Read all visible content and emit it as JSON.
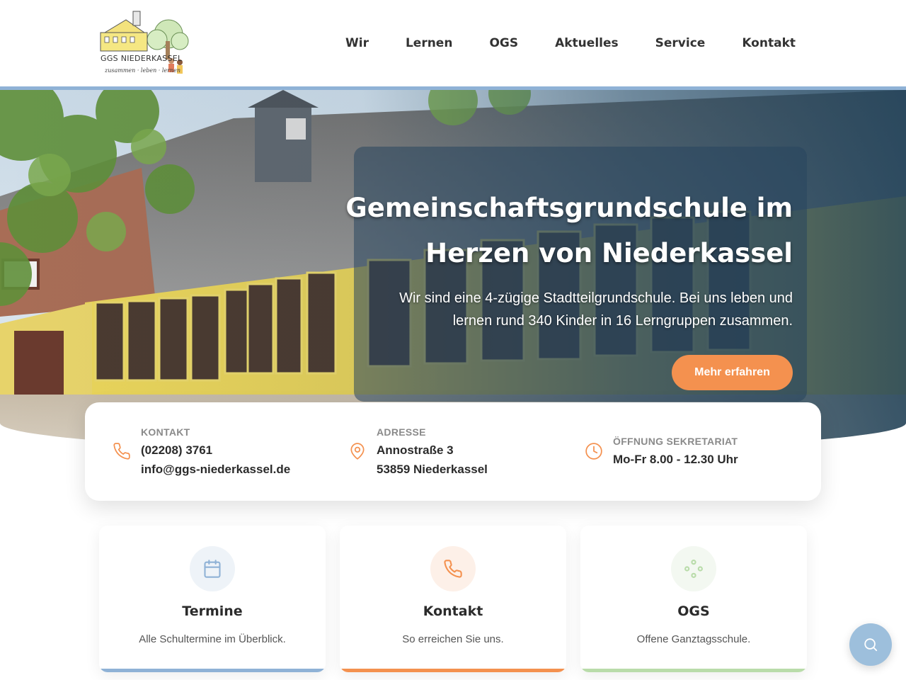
{
  "logo": {
    "name": "GGS NIEDERKASSEL",
    "tagline": "zusammen · leben · lernen"
  },
  "nav": {
    "items": [
      {
        "label": "Wir"
      },
      {
        "label": "Lernen"
      },
      {
        "label": "OGS"
      },
      {
        "label": "Aktuelles"
      },
      {
        "label": "Service"
      },
      {
        "label": "Kontakt"
      }
    ]
  },
  "hero": {
    "title_line1": "Gemeinschaftsgrundschule im",
    "title_line2": "Herzen von Niederkassel",
    "text_line1": "Wir sind eine 4-zügige Stadtteilgrundschule. Bei uns leben und",
    "text_line2": "lernen rund 340 Kinder in 16 Lerngruppen zusammen.",
    "button_label": "Mehr erfahren"
  },
  "info": {
    "contact": {
      "label": "KONTAKT",
      "phone": "(02208) 3761",
      "email": "info@ggs-niederkassel.de",
      "icon": "phone-icon"
    },
    "address": {
      "label": "ADRESSE",
      "street": "Annostraße 3",
      "city": "53859 Niederkassel",
      "icon": "map-pin-icon"
    },
    "hours": {
      "label": "ÖFFNUNG SEKRETARIAT",
      "value": "Mo-Fr 8.00 - 12.30 Uhr",
      "icon": "clock-icon"
    }
  },
  "cards": [
    {
      "title": "Termine",
      "desc": "Alle Schultermine im Überblick.",
      "icon": "calendar-icon",
      "color": "#8fb2d6",
      "bg": "#eef3f8"
    },
    {
      "title": "Kontakt",
      "desc": "So erreichen Sie uns.",
      "icon": "phone-icon",
      "color": "#f4914f",
      "bg": "#fdf0e8"
    },
    {
      "title": "OGS",
      "desc": "Offene Ganztagsschule.",
      "icon": "dots-icon",
      "color": "#b9dcaa",
      "bg": "#f3f8f1"
    }
  ],
  "colors": {
    "accent_orange": "#f4914f",
    "accent_blue": "#8fb2d6",
    "accent_green": "#b9dcaa"
  },
  "fab": {
    "icon": "search-icon"
  }
}
